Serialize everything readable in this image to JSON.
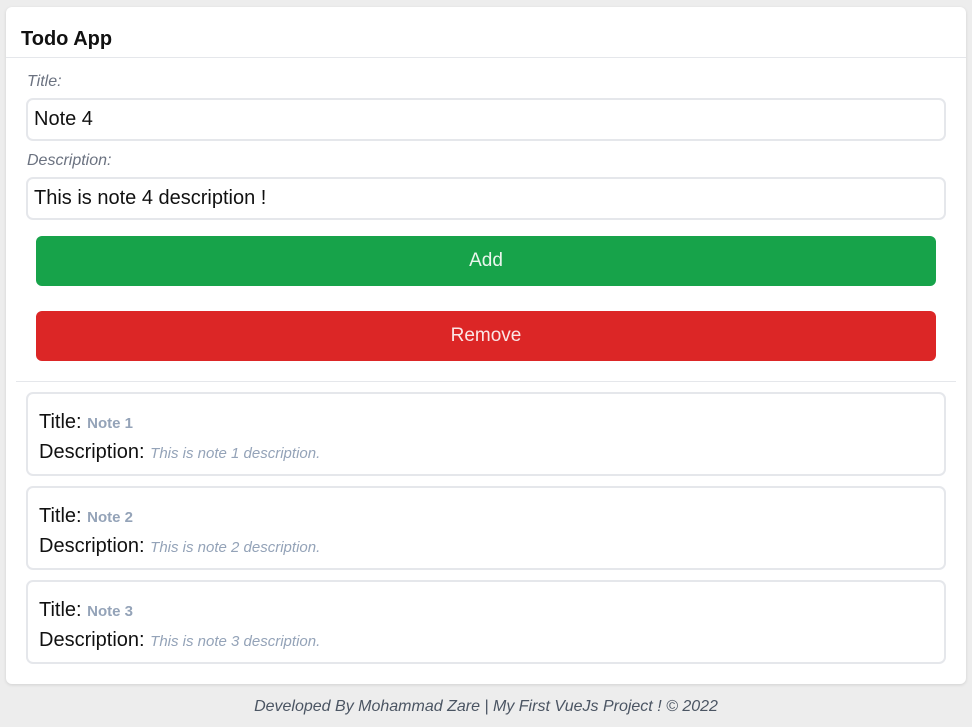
{
  "app": {
    "title": "Todo App"
  },
  "form": {
    "title_label": "Title:",
    "title_value": "Note 4",
    "description_label": "Description:",
    "description_value": "This is note 4 description !",
    "add_label": "Add",
    "remove_label": "Remove"
  },
  "notes": [
    {
      "title_label": "Title:",
      "title": "Note 1",
      "description_label": "Description:",
      "description": "This is note 1 description."
    },
    {
      "title_label": "Title:",
      "title": "Note 2",
      "description_label": "Description:",
      "description": "This is note 2 description."
    },
    {
      "title_label": "Title:",
      "title": "Note 3",
      "description_label": "Description:",
      "description": "This is note 3 description."
    }
  ],
  "footer": {
    "text": "Developed By Mohammad Zare | My First VueJs Project ! © 2022"
  },
  "colors": {
    "add_button": "#17a34a",
    "remove_button": "#dc2626",
    "background": "#ededed",
    "card": "#ffffff"
  }
}
